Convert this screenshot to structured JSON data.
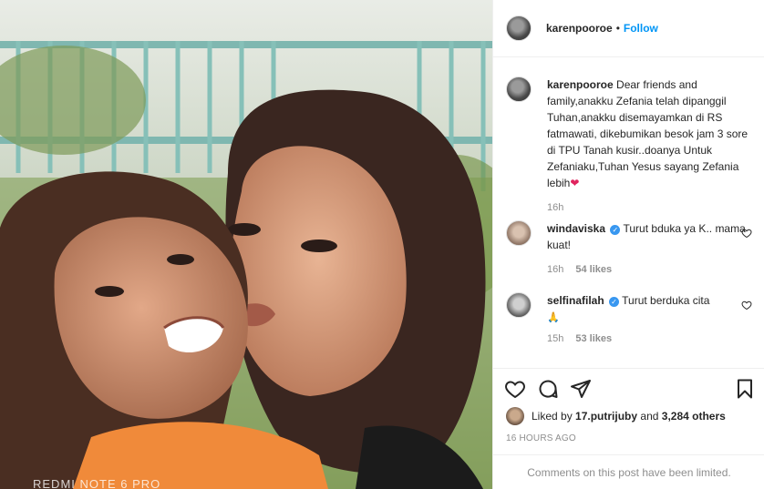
{
  "photo": {
    "watermark": "REDMI NOTE 6 PRO"
  },
  "header": {
    "username": "karenpooroe",
    "separator": "•",
    "follow_label": "Follow"
  },
  "caption": {
    "username": "karenpooroe",
    "text": "Dear friends and family,anakku Zefania telah dipanggil Tuhan,anakku disemayamkan di RS fatmawati, dikebumikan besok jam 3 sore di TPU Tanah kusir..doanya Untuk Zefaniaku,Tuhan Yesus sayang Zefania lebih",
    "emoji": "❤",
    "time": "16h"
  },
  "comments": [
    {
      "username": "windaviska",
      "verified": true,
      "text": "Turut bduka ya K.. mama kuat!",
      "time": "16h",
      "likes": "54 likes"
    },
    {
      "username": "selfinafilah",
      "verified": true,
      "text": "Turut berduka cita",
      "emoji": "🙏",
      "time": "15h",
      "likes": "53 likes"
    }
  ],
  "likes": {
    "prefix": "Liked by",
    "user": "17.putrijuby",
    "conj": "and",
    "others": "3,284 others"
  },
  "post_time": "16 HOURS AGO",
  "comments_limited": "Comments on this post have been limited.",
  "icons": [
    "heart-icon",
    "comment-icon",
    "share-icon",
    "bookmark-icon"
  ],
  "colors": {
    "follow": "#0095f6",
    "muted": "#8e8e8e",
    "verified": "#3897f0",
    "heart_emoji": "#e0245e"
  }
}
